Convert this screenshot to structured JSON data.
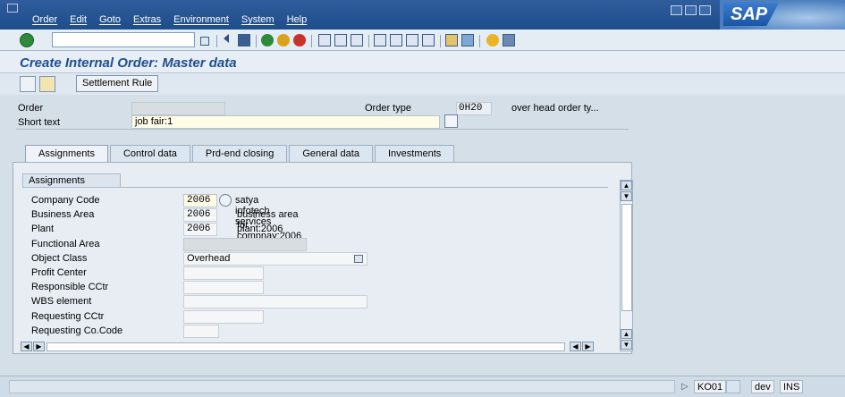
{
  "menubar": {
    "items": [
      "Order",
      "Edit",
      "Goto",
      "Extras",
      "Environment",
      "System",
      "Help"
    ],
    "logo": "SAP"
  },
  "title": "Create Internal Order: Master data",
  "app_toolbar": {
    "settlement_rule": "Settlement Rule"
  },
  "header": {
    "order_label": "Order",
    "order_value": "",
    "order_type_label": "Order type",
    "order_type_value": "0H20",
    "order_type_desc": "over head order ty...",
    "short_text_label": "Short text",
    "short_text_value": "job fair:1"
  },
  "tabs": [
    "Assignments",
    "Control data",
    "Prd-end closing",
    "General data",
    "Investments"
  ],
  "active_tab": "Assignments",
  "group_title": "Assignments",
  "fields": [
    {
      "label": "Company Code",
      "value": "2006",
      "desc": "satya infotech  services"
    },
    {
      "label": "Business Area",
      "value": "2006",
      "desc": "business area for compnay:2006"
    },
    {
      "label": "Plant",
      "value": "2006",
      "desc": "plant:2006"
    },
    {
      "label": "Functional Area",
      "value": "",
      "desc": ""
    },
    {
      "label": "Object Class",
      "value": "Overhead",
      "desc": ""
    },
    {
      "label": "Profit Center",
      "value": "",
      "desc": ""
    },
    {
      "label": "Responsible CCtr",
      "value": "",
      "desc": ""
    },
    {
      "label": "WBS element",
      "value": "",
      "desc": ""
    },
    {
      "label": "Requesting CCtr",
      "value": "",
      "desc": ""
    },
    {
      "label": "Requesting Co.Code",
      "value": "",
      "desc": ""
    }
  ],
  "statusbar": {
    "transaction": "KO01",
    "system": "dev",
    "mode": "INS"
  }
}
